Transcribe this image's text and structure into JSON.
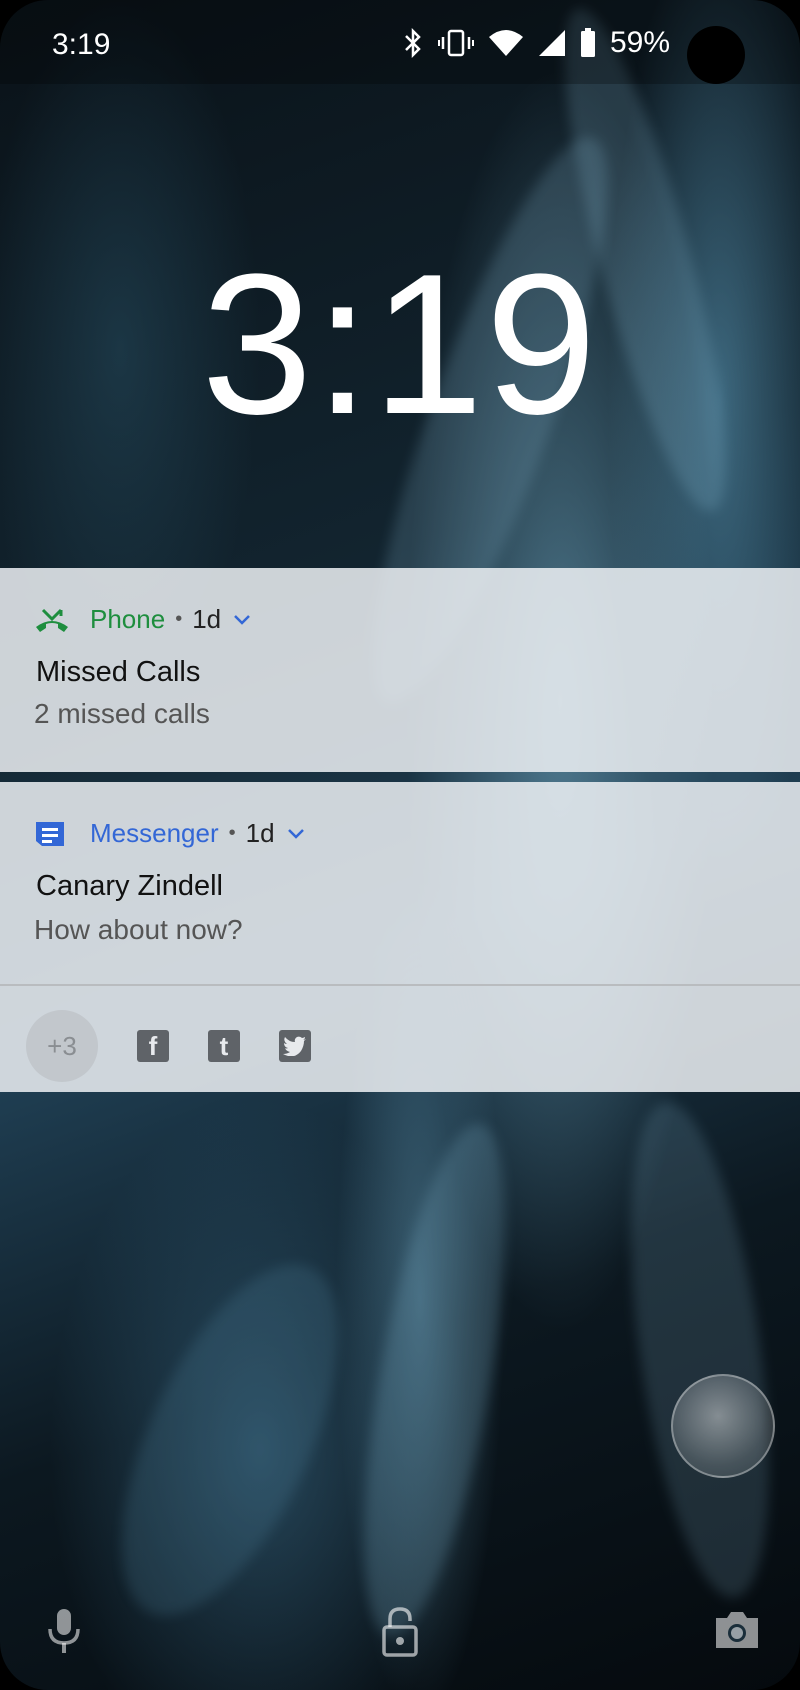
{
  "status_bar": {
    "time": "3:19",
    "battery_percent": "59%",
    "icons": [
      "bluetooth-icon",
      "vibrate-icon",
      "wifi-icon",
      "cell-signal-icon",
      "battery-icon"
    ]
  },
  "lock_clock": {
    "time": "3:19"
  },
  "notifications": [
    {
      "app": "Phone",
      "app_color": "#1e8e3e",
      "icon": "missed-call-icon",
      "age": "1d",
      "title": "Missed Calls",
      "text": "2 missed calls"
    },
    {
      "app": "Messenger",
      "app_color": "#3367d6",
      "icon": "message-icon",
      "age": "1d",
      "title": "Canary Zindell",
      "text": "How about now?"
    }
  ],
  "overflow": {
    "more_count": "+3",
    "app_icons": [
      {
        "name": "facebook-icon",
        "glyph": "f"
      },
      {
        "name": "tumblr-icon",
        "glyph": "t"
      },
      {
        "name": "twitter-icon",
        "glyph": ""
      }
    ]
  },
  "bottom_actions": [
    "microphone-icon",
    "lock-icon",
    "camera-icon"
  ]
}
